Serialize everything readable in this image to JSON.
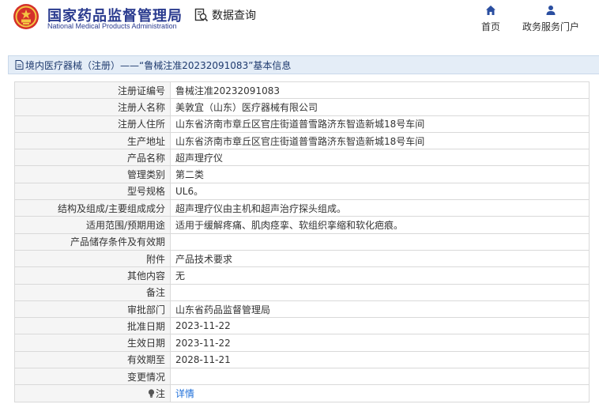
{
  "header": {
    "logo_cn": "国家药品监督管理局",
    "logo_en": "National Medical Products Administration",
    "data_query": "数据查询",
    "nav": [
      {
        "label": "首页",
        "icon": "home-icon"
      },
      {
        "label": "政务服务门户",
        "icon": "user-icon"
      }
    ]
  },
  "title": "境内医疗器械（注册）——“鲁械注准20232091083”基本信息",
  "rows": [
    {
      "label": "注册证编号",
      "value": "鲁械注准20232091083"
    },
    {
      "label": "注册人名称",
      "value": "美敦宜（山东）医疗器械有限公司"
    },
    {
      "label": "注册人住所",
      "value": "山东省济南市章丘区官庄街道普雪路济东智造新城18号车间"
    },
    {
      "label": "生产地址",
      "value": "山东省济南市章丘区官庄街道普雪路济东智造新城18号车间"
    },
    {
      "label": "产品名称",
      "value": "超声理疗仪"
    },
    {
      "label": "管理类别",
      "value": "第二类"
    },
    {
      "label": "型号规格",
      "value": "UL6。"
    },
    {
      "label": "结构及组成/主要组成成分",
      "value": "超声理疗仪由主机和超声治疗探头组成。"
    },
    {
      "label": "适用范围/预期用途",
      "value": "适用于缓解疼痛、肌肉痉挛、软组织挛缩和软化疤痕。"
    },
    {
      "label": "产品储存条件及有效期",
      "value": ""
    },
    {
      "label": "附件",
      "value": "产品技术要求"
    },
    {
      "label": "其他内容",
      "value": "无"
    },
    {
      "label": "备注",
      "value": ""
    },
    {
      "label": "审批部门",
      "value": "山东省药品监督管理局"
    },
    {
      "label": "批准日期",
      "value": "2023-11-22"
    },
    {
      "label": "生效日期",
      "value": "2023-11-22"
    },
    {
      "label": "有效期至",
      "value": "2028-11-21"
    },
    {
      "label": "变更情况",
      "value": ""
    }
  ],
  "note": {
    "label": "注",
    "value": "详情",
    "icon": "lightbulb-icon"
  },
  "colors": {
    "brand": "#2a3b8f",
    "title_bg": "#e4edf7",
    "link": "#1e6fd9"
  }
}
